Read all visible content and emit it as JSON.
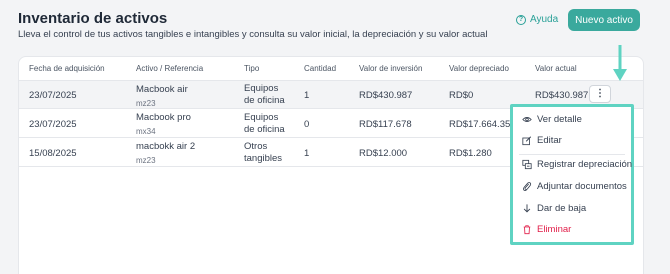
{
  "header": {
    "title": "Inventario de activos",
    "subtitle": "Lleva el control de tus activos tangibles e intangibles y consulta su valor inicial, la depreciación y su valor actual",
    "help_label": "Ayuda",
    "new_button_label": "Nuevo activo"
  },
  "table": {
    "columns": [
      "Fecha de adquisición",
      "Activo / Referencia",
      "Tipo",
      "Cantidad",
      "Valor de inversión",
      "Valor depreciado",
      "Valor actual"
    ],
    "rows": [
      {
        "fecha": "23/07/2025",
        "activo": "Macbook air",
        "ref": "mz23",
        "tipo1": "Equipos",
        "tipo2": "de oficina",
        "cantidad": "1",
        "inversion": "RD$430.987",
        "depreciado": "RD$0",
        "actual": "RD$430.987"
      },
      {
        "fecha": "23/07/2025",
        "activo": "Macbook pro",
        "ref": "mx34",
        "tipo1": "Equipos",
        "tipo2": "de oficina",
        "cantidad": "0",
        "inversion": "RD$117.678",
        "depreciado": "RD$17.664.35",
        "actual": ""
      },
      {
        "fecha": "15/08/2025",
        "activo": "macbokk air 2",
        "ref": "mz23",
        "tipo1": "Otros",
        "tipo2": "tangibles",
        "cantidad": "1",
        "inversion": "RD$12.000",
        "depreciado": "RD$1.280",
        "actual": ""
      }
    ]
  },
  "menu": {
    "items": [
      {
        "label": "Ver detalle",
        "icon": "eye-icon"
      },
      {
        "label": "Editar",
        "icon": "edit-icon"
      },
      {
        "label": "Registrar depreciación",
        "icon": "depreciation-icon"
      },
      {
        "label": "Adjuntar documentos",
        "icon": "paperclip-icon"
      },
      {
        "label": "Dar de baja",
        "icon": "arrow-down-icon"
      },
      {
        "label": "Eliminar",
        "icon": "trash-icon"
      }
    ]
  },
  "colors": {
    "accent": "#3aa99d",
    "highlight": "#5fd3c2",
    "danger": "#e11d48"
  }
}
